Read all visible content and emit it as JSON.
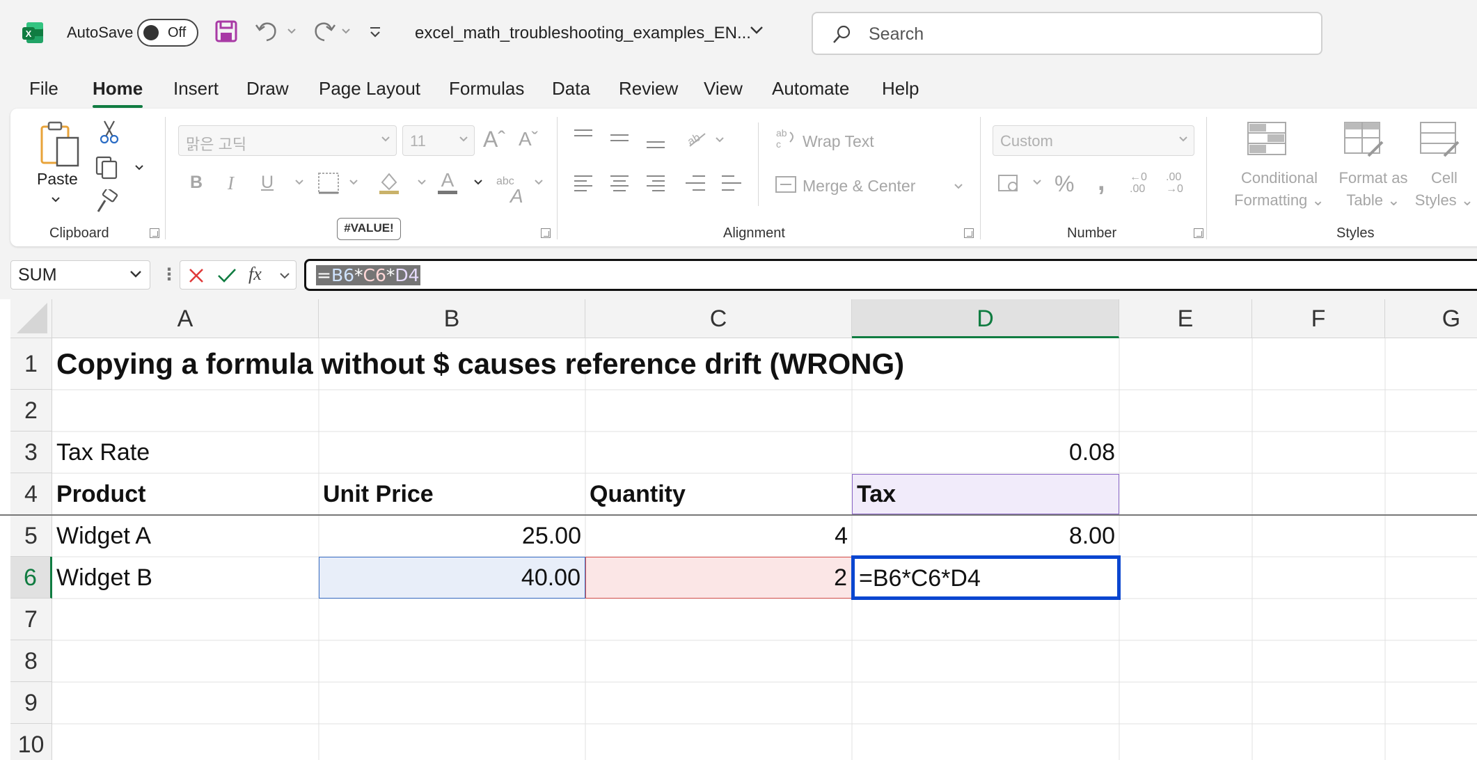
{
  "titlebar": {
    "autosave_label": "AutoSave",
    "autosave_state": "Off",
    "filename": "excel_math_troubleshooting_examples_EN...",
    "search_placeholder": "Search"
  },
  "tabs": [
    "File",
    "Home",
    "Insert",
    "Draw",
    "Page Layout",
    "Formulas",
    "Data",
    "Review",
    "View",
    "Automate",
    "Help"
  ],
  "active_tab": "Home",
  "ribbon": {
    "clipboard": {
      "label": "Clipboard",
      "paste": "Paste"
    },
    "font": {
      "name": "맑은 고딕",
      "size": "11"
    },
    "alignment": {
      "label": "Alignment",
      "wrap_text": "Wrap Text",
      "merge_center": "Merge & Center"
    },
    "number": {
      "label": "Number",
      "format": "Custom"
    },
    "styles": {
      "label": "Styles",
      "conditional": [
        "Conditional",
        "Formatting"
      ],
      "format_table": [
        "Format as",
        "Table"
      ],
      "cell_styles": [
        "Cell",
        "Styles"
      ]
    },
    "error_tooltip": "#VALUE!"
  },
  "formula_bar": {
    "name_box": "SUM",
    "eq": "=",
    "ref_b": "B6",
    "op1": "*",
    "ref_c": "C6",
    "op2": "*",
    "ref_d": "D4"
  },
  "sheet": {
    "columns": [
      "A",
      "B",
      "C",
      "D",
      "E",
      "F",
      "G"
    ],
    "selected_column": "D",
    "rows": [
      "1",
      "2",
      "3",
      "4",
      "5",
      "6",
      "7",
      "8",
      "9",
      "10"
    ],
    "selected_row": "6",
    "cells": {
      "A1": "Copying a formula without $ causes reference drift (WRONG)",
      "A3": "Tax Rate",
      "D3": "0.08",
      "A4": "Product",
      "B4": "Unit Price",
      "C4": "Quantity",
      "D4": "Tax",
      "A5": "Widget A",
      "B5": "25.00",
      "C5": "4",
      "D5": "8.00",
      "A6": "Widget B",
      "B6": "40.00",
      "C6": "2",
      "D6": "=B6*C6*D4"
    }
  },
  "colors": {
    "excel_green": "#107c41",
    "ref_blue": "#3a6fc7",
    "ref_red": "#d9534f",
    "ref_purple": "#8b67c8",
    "active_cell_border": "#0a46d0"
  }
}
